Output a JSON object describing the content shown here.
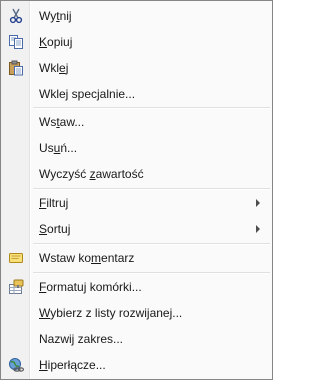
{
  "menu": {
    "items": [
      {
        "pre": "Wy",
        "key": "t",
        "post": "nij"
      },
      {
        "pre": "",
        "key": "K",
        "post": "opiuj"
      },
      {
        "pre": "Wkl",
        "key": "e",
        "post": "j"
      },
      {
        "pre": "Wklej specjalnie...",
        "key": "",
        "post": ""
      },
      {
        "pre": "Ws",
        "key": "t",
        "post": "aw..."
      },
      {
        "pre": "Us",
        "key": "u",
        "post": "ń..."
      },
      {
        "pre": "Wyczyść ",
        "key": "z",
        "post": "awartość"
      },
      {
        "pre": "",
        "key": "F",
        "post": "iltruj"
      },
      {
        "pre": "",
        "key": "S",
        "post": "ortuj"
      },
      {
        "pre": "Wstaw ko",
        "key": "m",
        "post": "entarz"
      },
      {
        "pre": "",
        "key": "F",
        "post": "ormatuj komórki..."
      },
      {
        "pre": "",
        "key": "W",
        "post": "ybierz z listy rozwijanej..."
      },
      {
        "pre": "Nazwij zakres...",
        "key": "",
        "post": ""
      },
      {
        "pre": "",
        "key": "H",
        "post": "iperłącze..."
      }
    ]
  },
  "icons": {
    "cut": "scissors-icon",
    "copy": "copy-icon",
    "paste": "paste-icon",
    "comment": "comment-icon",
    "format": "format-cells-icon",
    "link": "hyperlink-icon"
  },
  "colors": {
    "border": "#868686",
    "gutter": "#f1f1f1",
    "separator": "#e0e0e0",
    "text": "#1a1a1a"
  }
}
